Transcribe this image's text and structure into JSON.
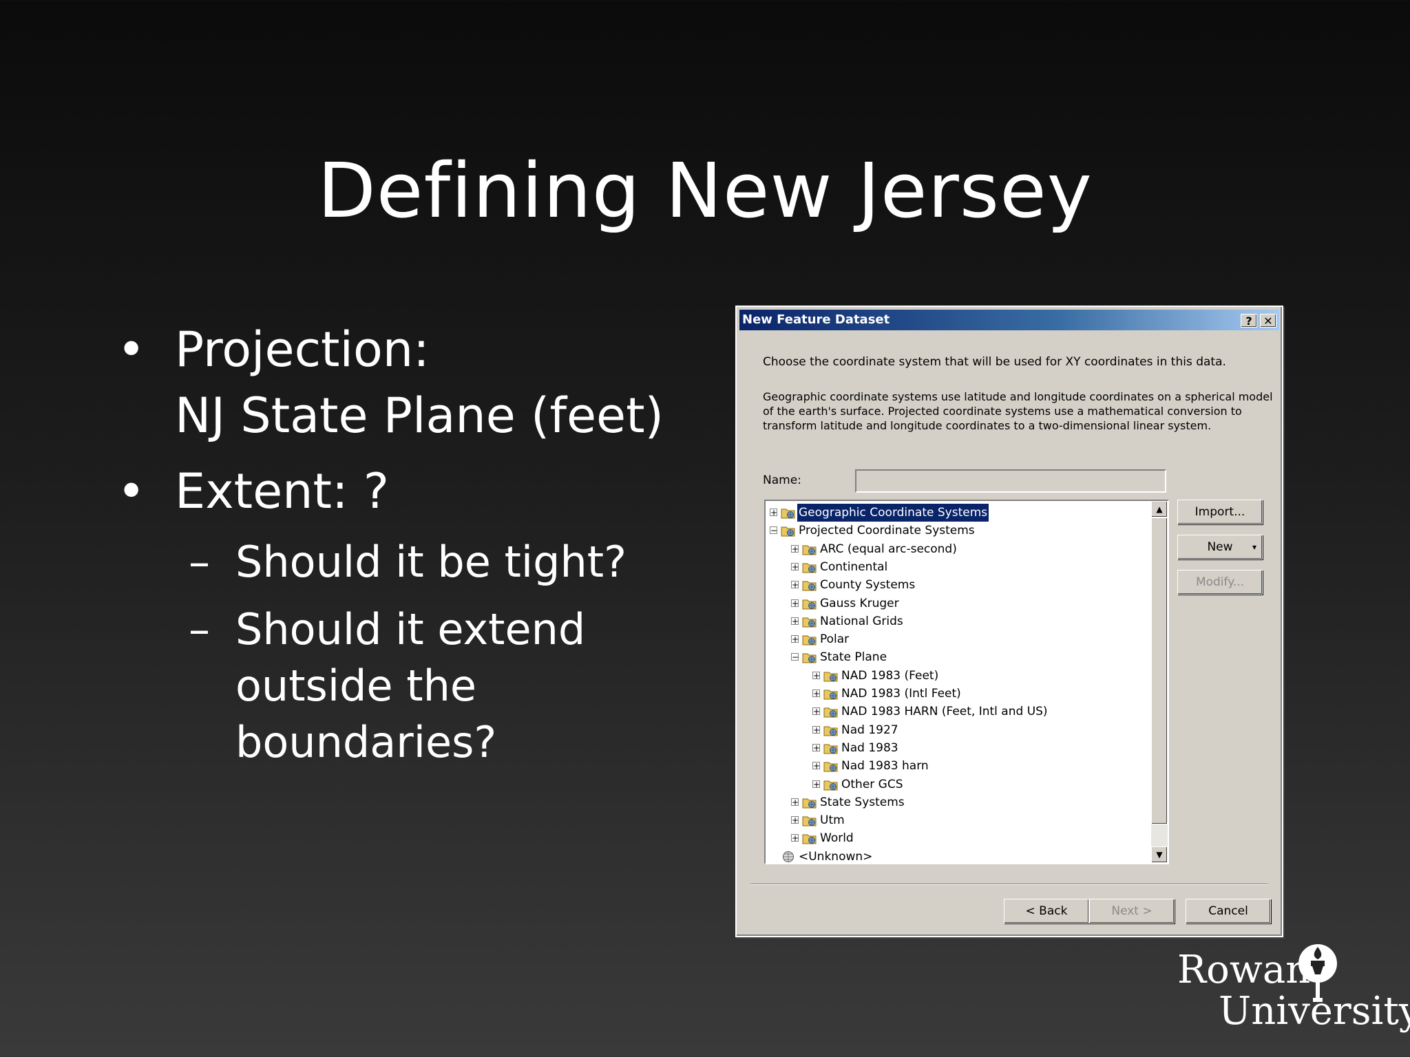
{
  "slide": {
    "title": "Defining New Jersey",
    "bullets": [
      {
        "marker": "•",
        "lines": [
          "Projection:",
          "NJ State Plane (feet)"
        ]
      },
      {
        "marker": "•",
        "lines": [
          "Extent: ?"
        ]
      }
    ],
    "sub_bullets": [
      {
        "marker": "–",
        "lines": [
          "Should it be tight?"
        ]
      },
      {
        "marker": "–",
        "lines": [
          "Should it extend",
          "outside the",
          "boundaries?"
        ]
      }
    ]
  },
  "dialog": {
    "title": "New Feature Dataset",
    "help_button": "?",
    "close_button": "✕",
    "instruction": "Choose the coordinate system that will be used for XY coordinates in this data.",
    "description_lines": [
      "Geographic coordinate systems use latitude and longitude coordinates on a spherical model",
      "of the earth's surface. Projected coordinate systems use a mathematical conversion to",
      "transform latitude and longitude coordinates to a two-dimensional linear system."
    ],
    "name_label": "Name:",
    "name_value": "",
    "tree": [
      {
        "label": "Geographic Coordinate Systems",
        "level": 0,
        "expander": "+",
        "selected": true,
        "icon": "folder-globe-icon"
      },
      {
        "label": "Projected Coordinate Systems",
        "level": 0,
        "expander": "−",
        "icon": "folder-globe-icon"
      },
      {
        "label": "ARC (equal arc-second)",
        "level": 1,
        "expander": "+",
        "icon": "folder-globe-icon"
      },
      {
        "label": "Continental",
        "level": 1,
        "expander": "+",
        "icon": "folder-globe-icon"
      },
      {
        "label": "County Systems",
        "level": 1,
        "expander": "+",
        "icon": "folder-globe-icon"
      },
      {
        "label": "Gauss Kruger",
        "level": 1,
        "expander": "+",
        "icon": "folder-globe-icon"
      },
      {
        "label": "National Grids",
        "level": 1,
        "expander": "+",
        "icon": "folder-globe-icon"
      },
      {
        "label": "Polar",
        "level": 1,
        "expander": "+",
        "icon": "folder-globe-icon"
      },
      {
        "label": "State Plane",
        "level": 1,
        "expander": "−",
        "icon": "folder-globe-icon"
      },
      {
        "label": "NAD 1983 (Feet)",
        "level": 2,
        "expander": "+",
        "icon": "folder-globe-icon"
      },
      {
        "label": "NAD 1983 (Intl Feet)",
        "level": 2,
        "expander": "+",
        "icon": "folder-globe-icon"
      },
      {
        "label": "NAD 1983 HARN (Feet, Intl and US)",
        "level": 2,
        "expander": "+",
        "icon": "folder-globe-icon"
      },
      {
        "label": "Nad 1927",
        "level": 2,
        "expander": "+",
        "icon": "folder-globe-icon"
      },
      {
        "label": "Nad 1983",
        "level": 2,
        "expander": "+",
        "icon": "folder-globe-icon"
      },
      {
        "label": "Nad 1983 harn",
        "level": 2,
        "expander": "+",
        "icon": "folder-globe-icon"
      },
      {
        "label": "Other GCS",
        "level": 2,
        "expander": "+",
        "icon": "folder-globe-icon"
      },
      {
        "label": "State Systems",
        "level": 1,
        "expander": "+",
        "icon": "folder-globe-icon"
      },
      {
        "label": "Utm",
        "level": 1,
        "expander": "+",
        "icon": "folder-globe-icon"
      },
      {
        "label": "World",
        "level": 1,
        "expander": "+",
        "icon": "folder-globe-icon"
      },
      {
        "label": "<Unknown>",
        "level": 0,
        "expander": "",
        "icon": "globe-icon"
      }
    ],
    "side_buttons": {
      "import": "Import...",
      "new": "New",
      "new_arrow": "▾",
      "modify": "Modify..."
    },
    "footer_buttons": {
      "back": "< Back",
      "next": "Next >",
      "cancel": "Cancel"
    },
    "scroll": {
      "up": "▲",
      "down": "▼"
    }
  },
  "logo": {
    "line1": "Rowan",
    "line2": "University"
  },
  "colors": {
    "titlebar_start": "#0a246a",
    "titlebar_end": "#a6caf0",
    "selection": "#0a246a",
    "dialog_bg": "#d4d0c8"
  }
}
